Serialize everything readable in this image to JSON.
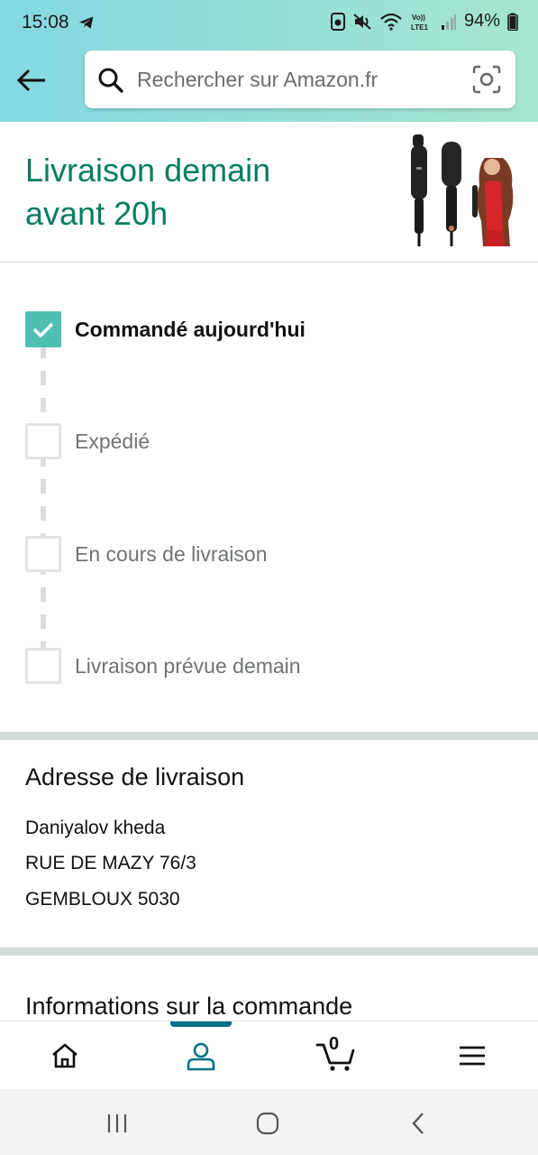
{
  "status_bar": {
    "time": "15:08",
    "volte_label_top": "Vo))",
    "volte_label_bottom": "LTE1",
    "battery_percent": "94%"
  },
  "search": {
    "placeholder": "Rechercher sur Amazon.fr"
  },
  "delivery": {
    "title": "Livraison demain avant 20h"
  },
  "tracker": {
    "steps": [
      {
        "label": "Commandé aujourd'hui",
        "done": true
      },
      {
        "label": "Expédié",
        "done": false
      },
      {
        "label": "En cours de livraison",
        "done": false
      },
      {
        "label": "Livraison prévue demain",
        "done": false
      }
    ]
  },
  "address": {
    "title": "Adresse de livraison",
    "name": "Daniyalov kheda",
    "street": "RUE DE MAZY 76/3",
    "city": "GEMBLOUX 5030"
  },
  "order_info": {
    "title": "Informations sur la commande"
  },
  "bottom_nav": {
    "items": [
      {
        "icon": "home-icon"
      },
      {
        "icon": "account-icon",
        "active": true
      },
      {
        "icon": "cart-icon",
        "count": "0"
      },
      {
        "icon": "menu-icon"
      }
    ]
  },
  "colors": {
    "accent": "#007185",
    "delivery_green": "#067d62",
    "check_teal": "#4fbfb3"
  }
}
